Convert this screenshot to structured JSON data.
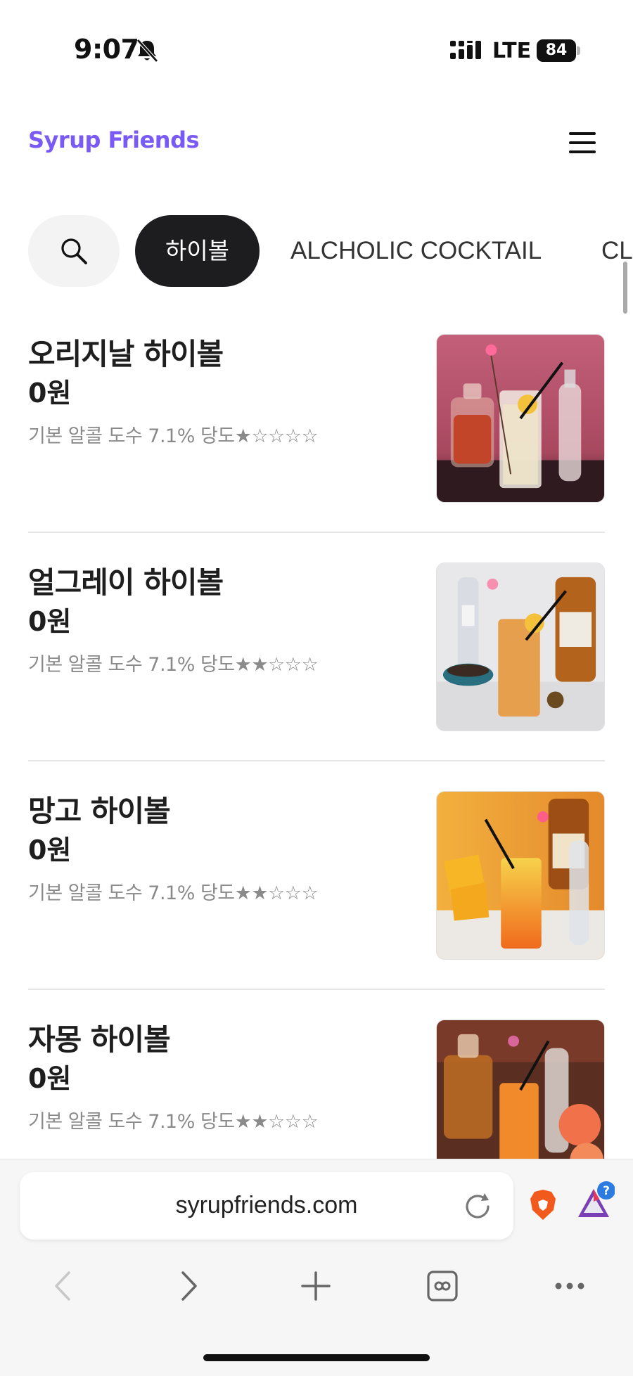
{
  "status_bar": {
    "time": "9:07",
    "network": "LTE",
    "battery": "84"
  },
  "header": {
    "brand": "Syrup Friends",
    "accent_color": "#7a5af5",
    "menu_icon": "hamburger-icon"
  },
  "categories": {
    "search_icon": "search-icon",
    "items": [
      {
        "label": "하이볼",
        "active": true
      },
      {
        "label": "ALCHOLIC COCKTAIL",
        "active": false
      },
      {
        "label": "CL",
        "active": false
      }
    ]
  },
  "products": [
    {
      "name": "오리지날 하이볼",
      "price": "0원",
      "desc": "기본 알콜 도수 7.1%  당도★☆☆☆☆",
      "sweetness": 1
    },
    {
      "name": "얼그레이 하이볼",
      "price": "0원",
      "desc": "기본 알콜 도수 7.1%  당도★★☆☆☆",
      "sweetness": 2
    },
    {
      "name": "망고 하이볼",
      "price": "0원",
      "desc": "기본 알콜 도수 7.1%  당도★★☆☆☆",
      "sweetness": 2
    },
    {
      "name": "자몽 하이볼",
      "price": "0원",
      "desc": "기본 알콜 도수 7.1%  당도★★☆☆☆",
      "sweetness": 2
    }
  ],
  "browser": {
    "url": "syrupfriends.com",
    "rewards_badge": "?",
    "nav_icons": [
      "back-icon",
      "forward-icon",
      "new-tab-icon",
      "tabs-icon",
      "more-icon"
    ]
  }
}
